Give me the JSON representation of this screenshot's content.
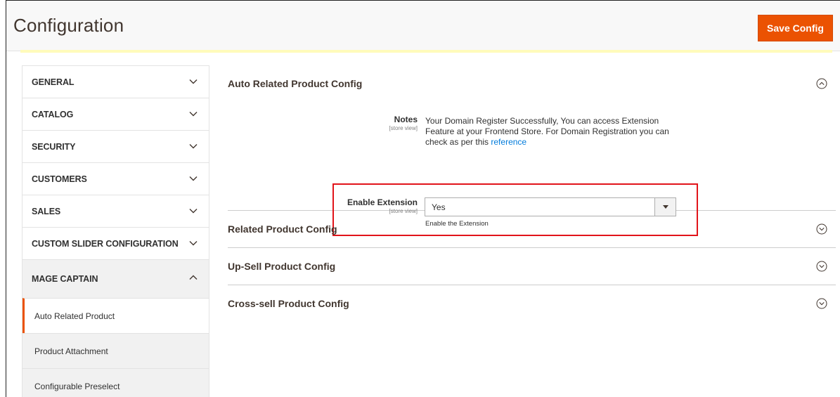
{
  "header": {
    "title": "Configuration",
    "save_label": "Save Config",
    "accent_color": "#eb5202"
  },
  "sidebar": {
    "sections": [
      {
        "label": "GENERAL",
        "expanded": false
      },
      {
        "label": "CATALOG",
        "expanded": false
      },
      {
        "label": "SECURITY",
        "expanded": false
      },
      {
        "label": "CUSTOMERS",
        "expanded": false
      },
      {
        "label": "SALES",
        "expanded": false
      },
      {
        "label": "CUSTOM SLIDER CONFIGURATION",
        "expanded": false
      },
      {
        "label": "MAGE CAPTAIN",
        "expanded": true
      }
    ],
    "sub_items": [
      {
        "label": "Auto Related Product",
        "active": true
      },
      {
        "label": "Product Attachment",
        "active": false
      },
      {
        "label": "Configurable Preselect",
        "active": false
      }
    ]
  },
  "main": {
    "sections": [
      {
        "title": "Auto Related Product Config",
        "expanded": true
      },
      {
        "title": "Related Product Config",
        "expanded": false
      },
      {
        "title": "Up-Sell Product Config",
        "expanded": false
      },
      {
        "title": "Cross-sell Product Config",
        "expanded": false
      }
    ],
    "notes": {
      "label": "Notes",
      "scope": "[store view]",
      "text": "Your Domain Register Successfully, You can access Extension Feature at your Frontend Store. For Domain Registration you can check as per this",
      "link_text": "reference"
    },
    "enable_extension": {
      "label": "Enable Extension",
      "scope": "[store view]",
      "value": "Yes",
      "comment": "Enable the Extension"
    }
  }
}
